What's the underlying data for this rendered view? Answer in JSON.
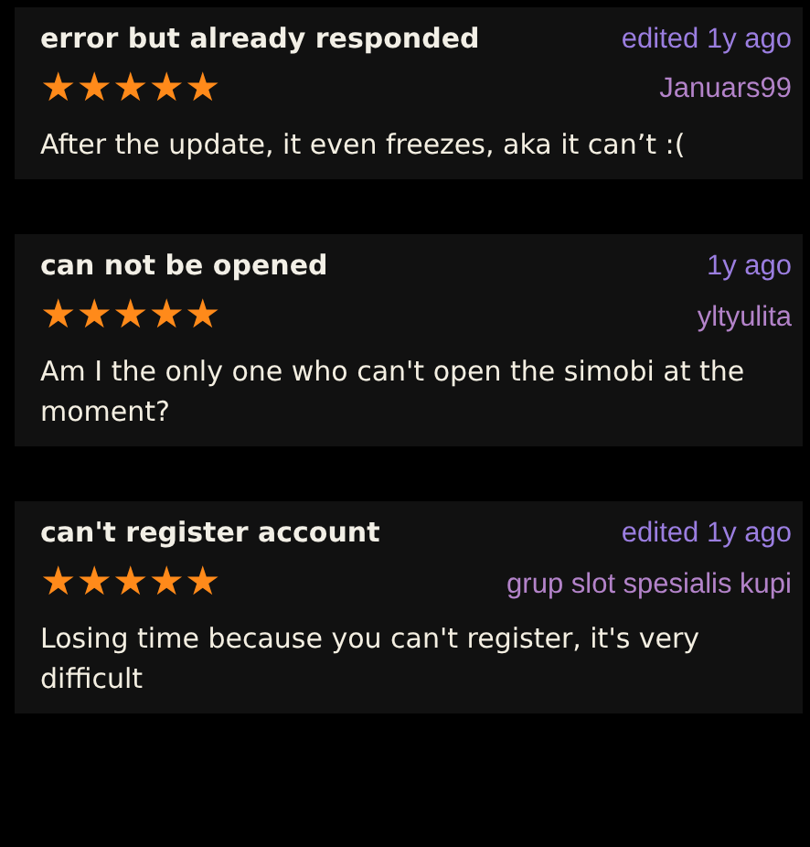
{
  "reviews": [
    {
      "title": "error but already responded",
      "time": "edited 1y ago",
      "stars": 5,
      "author": "Januars99",
      "body": "After the update, it even freezes, aka it can’t :("
    },
    {
      "title": "can not be opened",
      "time": "1y ago",
      "stars": 5,
      "author": "yltyulita",
      "body": "Am I the only one who can't open the simobi at the moment?"
    },
    {
      "title": "can't register account",
      "time": "edited 1y ago",
      "stars": 5,
      "author": "grup slot spesialis kupi",
      "body": "Losing time because you can't register, it's very difficult"
    }
  ]
}
